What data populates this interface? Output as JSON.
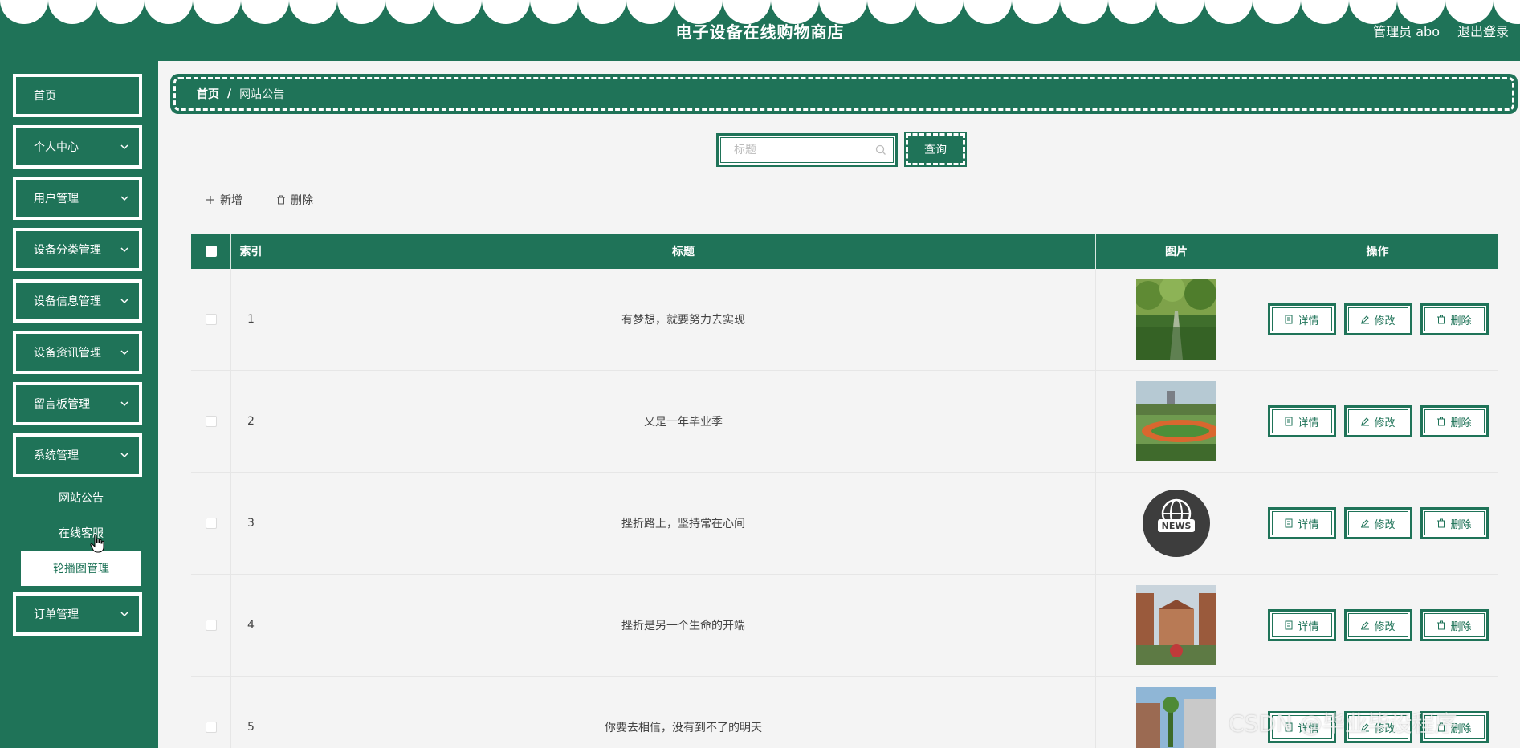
{
  "header": {
    "title": "电子设备在线购物商店",
    "user_label": "管理员 abo",
    "logout_label": "退出登录"
  },
  "sidebar": {
    "items": [
      {
        "label": "首页"
      },
      {
        "label": "个人中心"
      },
      {
        "label": "用户管理"
      },
      {
        "label": "设备分类管理"
      },
      {
        "label": "设备信息管理"
      },
      {
        "label": "设备资讯管理"
      },
      {
        "label": "留言板管理"
      },
      {
        "label": "系统管理"
      },
      {
        "label": "订单管理"
      }
    ],
    "submenu": [
      {
        "label": "网站公告"
      },
      {
        "label": "在线客服"
      },
      {
        "label": "轮播图管理"
      }
    ]
  },
  "breadcrumb": {
    "home": "首页",
    "separator": "/",
    "current": "网站公告"
  },
  "search": {
    "placeholder": "标题",
    "value": "",
    "button_label": "查询"
  },
  "toolbar": {
    "add_label": "新增",
    "delete_label": "删除"
  },
  "table": {
    "headers": {
      "index": "索引",
      "title": "标题",
      "image": "图片",
      "actions": "操作"
    },
    "actions": {
      "detail": "详情",
      "edit": "修改",
      "delete": "删除"
    },
    "rows": [
      {
        "index": "1",
        "title": "有梦想，就要努力去实现",
        "image": "park-trees-photo"
      },
      {
        "index": "2",
        "title": "又是一年毕业季",
        "image": "campus-track-photo"
      },
      {
        "index": "3",
        "title": "挫折路上，坚持常在心间",
        "image": "news-globe-icon",
        "image_text": "NEWS"
      },
      {
        "index": "4",
        "title": "挫折是另一个生命的开端",
        "image": "campus-building-photo"
      },
      {
        "index": "5",
        "title": "你要去相信，没有到不了的明天",
        "image": "campus-pool-photo"
      }
    ]
  },
  "watermark": "CSDN @毕业毕设程序",
  "colors": {
    "primary": "#1f7358",
    "background": "#f4f4f4",
    "white": "#ffffff"
  }
}
